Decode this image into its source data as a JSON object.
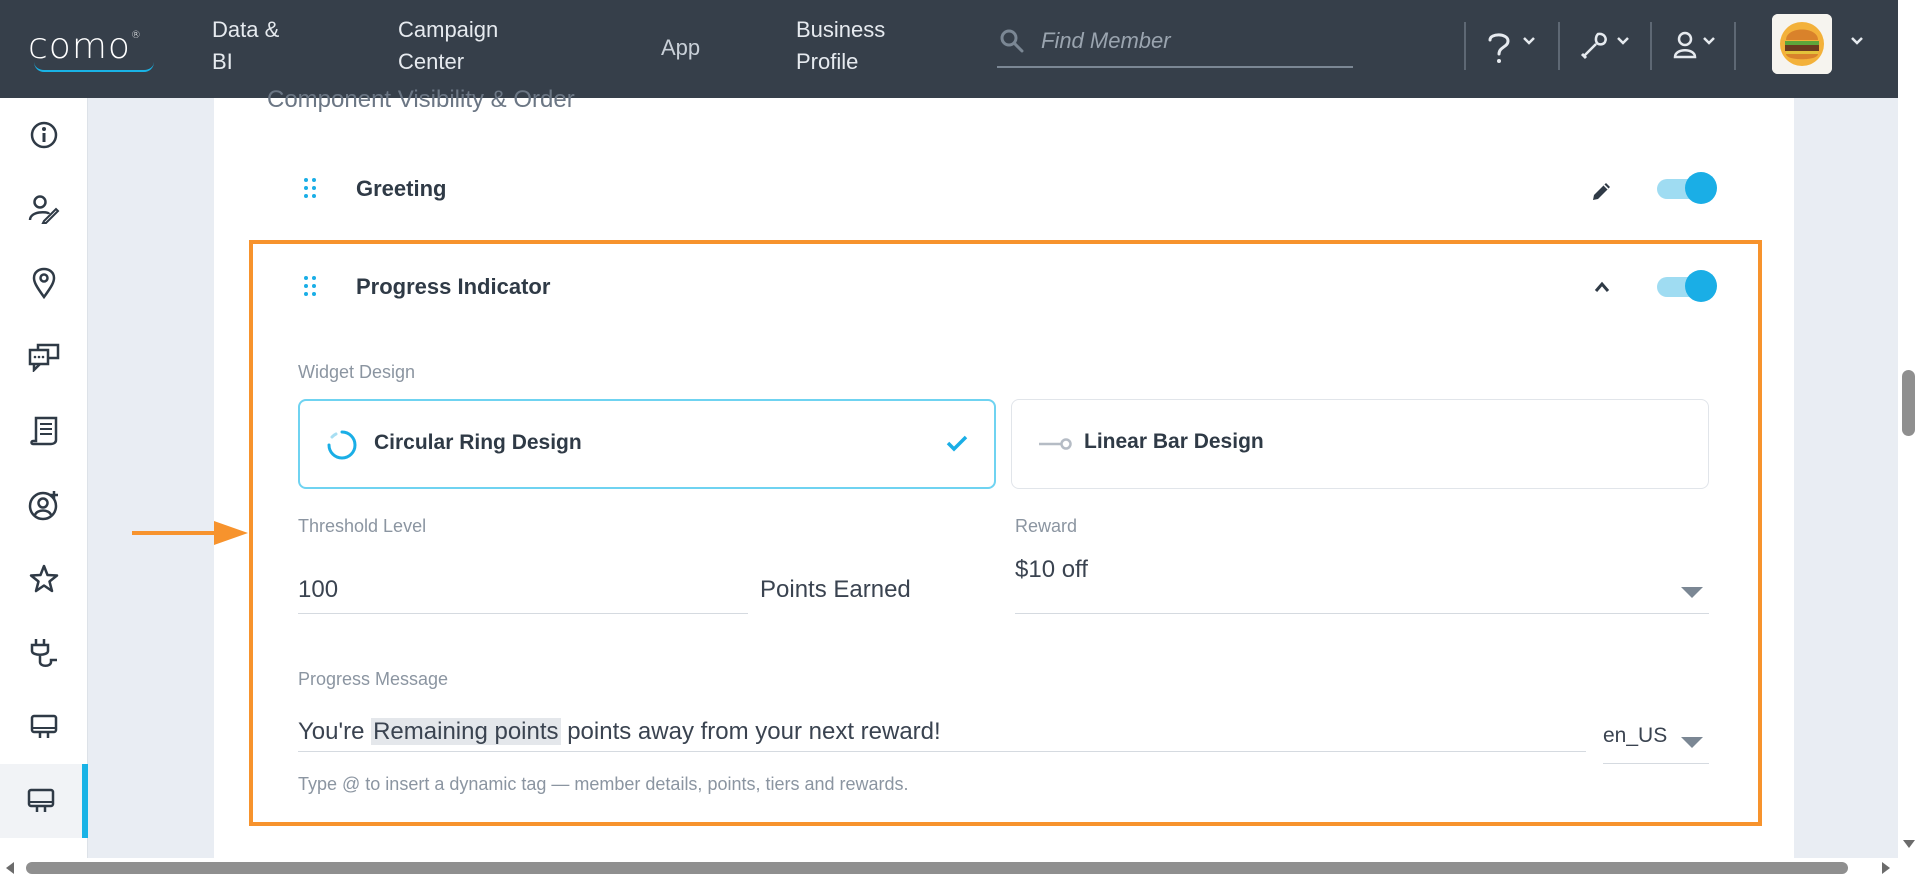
{
  "app": {
    "logo_text": "como"
  },
  "topnav": {
    "items": [
      {
        "line1": "Data &",
        "line2": "BI"
      },
      {
        "line1": "Campaign",
        "line2": "Center"
      },
      {
        "line1": "App",
        "line2": ""
      },
      {
        "line1": "Business",
        "line2": "Profile"
      }
    ],
    "search_placeholder": "Find Member",
    "icons": [
      "help-icon",
      "wrench-icon",
      "user-icon",
      "restaurant-avatar"
    ]
  },
  "sidebar": {
    "icons": [
      "info-icon",
      "user-edit-icon",
      "location-pin-icon",
      "chat-icon",
      "receipt-icon",
      "user-add-icon",
      "star-icon",
      "plug-icon",
      "monitor-icon",
      "monitor-icon-active"
    ]
  },
  "section": {
    "title": "Component Visibility & Order",
    "components": [
      {
        "name": "Greeting",
        "enabled": true
      },
      {
        "name": "Progress Indicator",
        "enabled": true,
        "expanded": true
      }
    ]
  },
  "progress_indicator": {
    "widget_design_label": "Widget Design",
    "designs": [
      {
        "label": "Circular Ring Design",
        "selected": true
      },
      {
        "label": "Linear Bar Design",
        "selected": false
      }
    ],
    "threshold_label": "Threshold Level",
    "threshold_value": "100",
    "threshold_unit": "Points Earned",
    "reward_label": "Reward",
    "reward_value": "$10 off",
    "message_label": "Progress Message",
    "message_prefix": "You're ",
    "message_tag": "Remaining points",
    "message_suffix": " points away from your next reward!",
    "locale": "en_US",
    "hint": "Type @ to insert a dynamic tag — member details, points, tiers and rewards."
  },
  "colors": {
    "topbar": "#363f4a",
    "accent": "#1aaee6",
    "highlight": "#f7932d"
  }
}
